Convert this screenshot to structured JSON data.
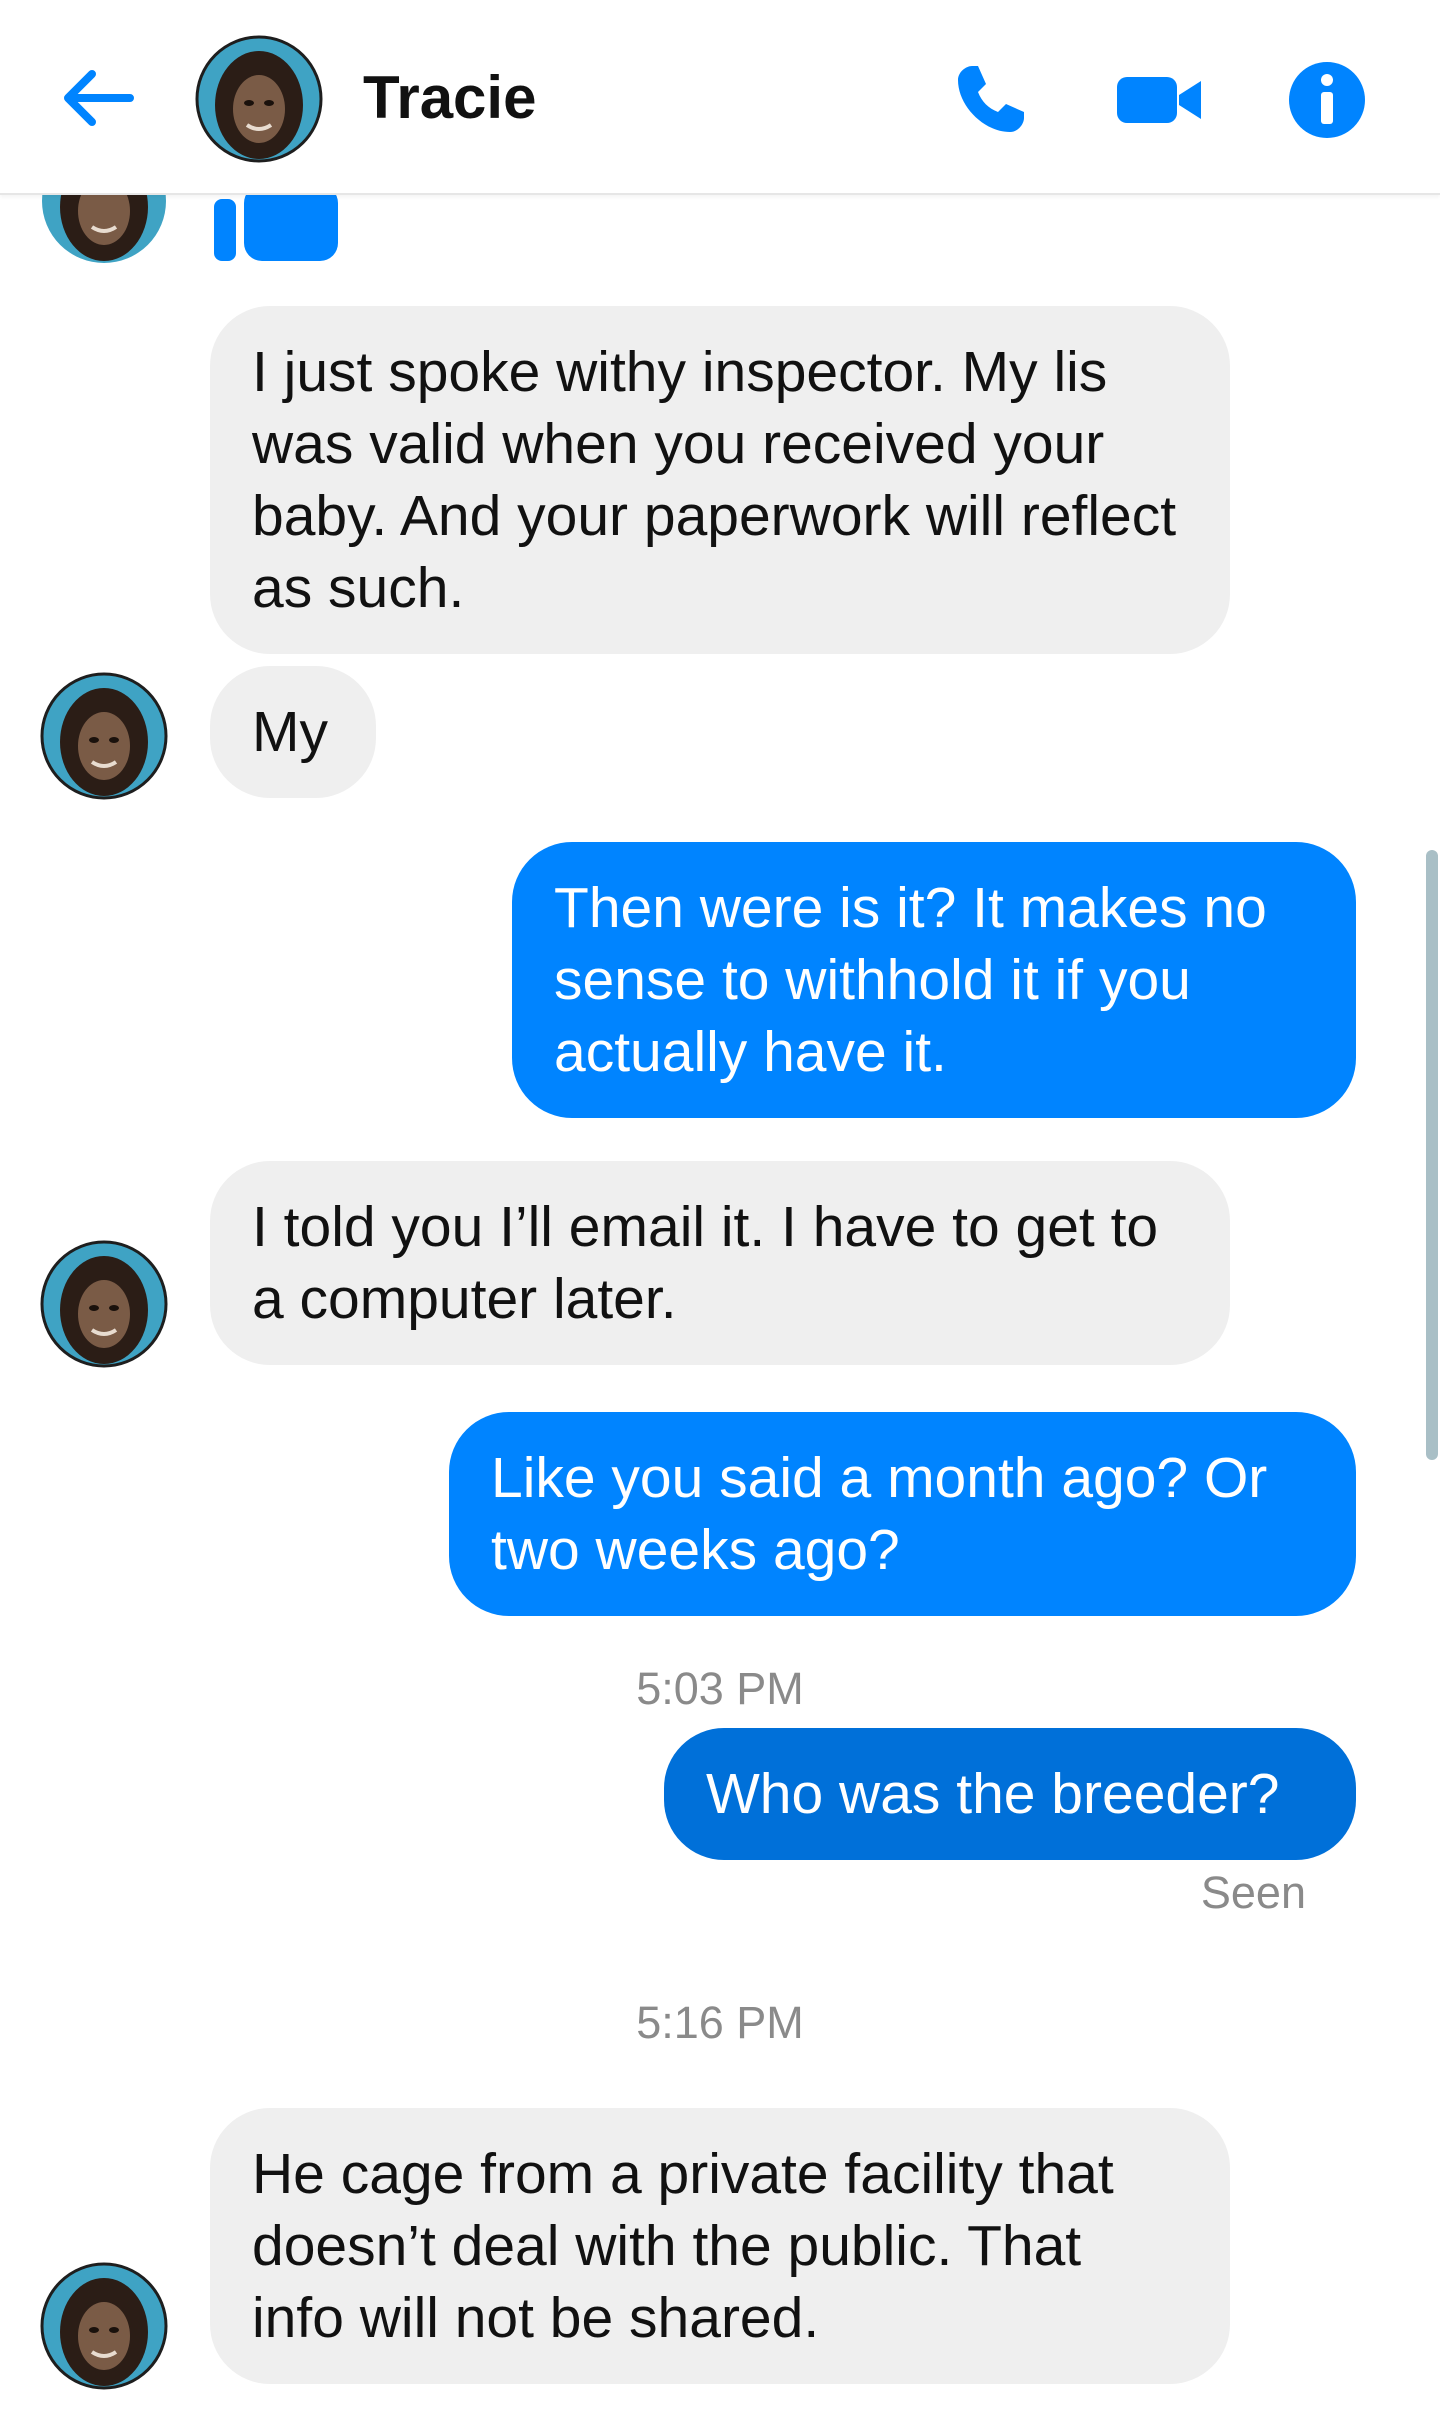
{
  "header": {
    "contact_name": "Tracie",
    "icons": [
      "back-arrow-icon",
      "phone-icon",
      "video-camera-icon",
      "info-icon"
    ],
    "accent_color": "#0084ff"
  },
  "messages": [
    {
      "from": "them",
      "type": "like",
      "icon": "thumbs-up-icon"
    },
    {
      "from": "them",
      "text": "I just spoke withy inspector. My lis was valid when you received your baby. And your paperwork will reflect as such."
    },
    {
      "from": "them",
      "text": "My"
    },
    {
      "from": "me",
      "text": "Then were is it? It makes no sense to withhold it if you actually have it."
    },
    {
      "from": "them",
      "text": "I told you I’ll email it. I have to get to a computer later."
    },
    {
      "from": "me",
      "text": "Like you said a month ago? Or two weeks ago?"
    },
    {
      "type": "timestamp",
      "text": "5:03 PM"
    },
    {
      "from": "me",
      "text": "Who was the breeder?"
    },
    {
      "type": "status",
      "text": "Seen"
    },
    {
      "type": "timestamp",
      "text": "5:16 PM"
    },
    {
      "from": "them",
      "text": "He cage from a private facility that doesn’t deal with the public. That info will not be shared."
    }
  ]
}
